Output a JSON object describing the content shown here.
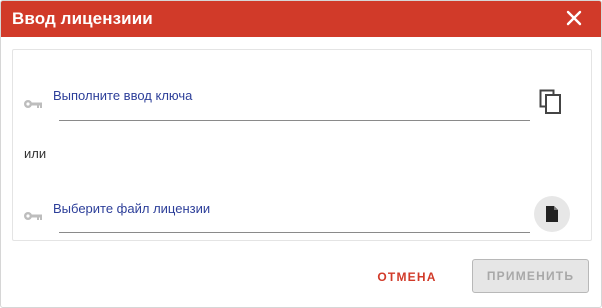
{
  "dialog": {
    "title": "Ввод лицензиии",
    "close_icon": "close-icon",
    "accent_color": "#d13a29"
  },
  "key_input": {
    "icon": "key-icon",
    "placeholder": "Выполните ввод ключа",
    "value": "",
    "action_icon": "copy-icon"
  },
  "separator_text": "или",
  "file_input": {
    "icon": "key-icon",
    "placeholder": "Выберите файл лицензии",
    "value": "",
    "action_icon": "file-icon"
  },
  "footer": {
    "cancel_label": "ОТМЕНА",
    "apply_label": "ПРИМЕНИТЬ",
    "apply_disabled": true
  }
}
